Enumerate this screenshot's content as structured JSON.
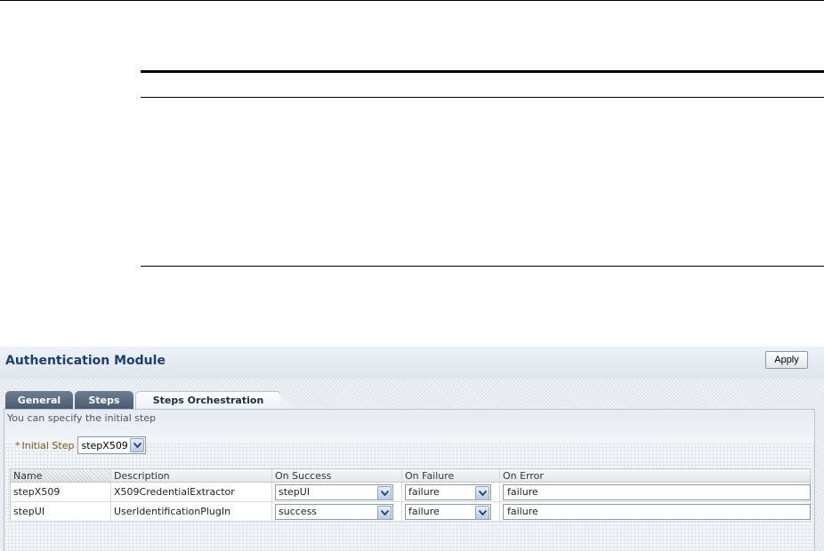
{
  "module": {
    "title": "Authentication Module",
    "apply_label": "Apply"
  },
  "tabs": [
    {
      "label": "General"
    },
    {
      "label": "Steps"
    },
    {
      "label": "Steps Orchestration",
      "selected": true
    }
  ],
  "panel": {
    "hint": "You can specify the initial step",
    "initial_step": {
      "required_marker": "*",
      "label": "Initial Step",
      "value": "stepX509"
    }
  },
  "table": {
    "columns": [
      "Name",
      "Description",
      "On Success",
      "On Failure",
      "On Error"
    ],
    "rows": [
      {
        "name": "stepX509",
        "description": "X509CredentialExtractor",
        "on_success": "stepUI",
        "on_failure": "failure",
        "on_error": "failure"
      },
      {
        "name": "stepUI",
        "description": "UserIdentificationPlugIn",
        "on_success": "success",
        "on_failure": "failure",
        "on_error": "failure"
      }
    ]
  },
  "icons": {
    "dropdown": "chevron-down-icon"
  },
  "colors": {
    "title": "#1f3f6b",
    "tab_inactive": "#4a5a70",
    "required": "#c0392b",
    "label": "#7a5a14"
  }
}
